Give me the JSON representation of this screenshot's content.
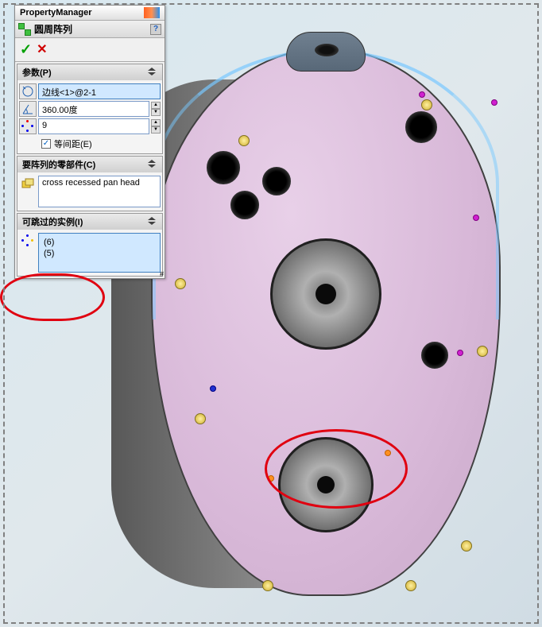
{
  "panel": {
    "title": "PropertyManager",
    "feature_name": "圆周阵列",
    "help": "?",
    "ok": "✓",
    "cancel": "✕"
  },
  "sections": {
    "params": {
      "title": "参数(P)",
      "axis_value": "边线<1>@2-1",
      "angle_value": "360.00度",
      "count_value": "9",
      "equal_spacing_label": "等间距(E)",
      "equal_spacing_checked": "✓"
    },
    "components": {
      "title": "要阵列的零部件(C)",
      "item": "cross recessed pan head"
    },
    "skip": {
      "title": "可跳过的实例(I)",
      "items": [
        "(6)",
        "(5)"
      ]
    }
  }
}
